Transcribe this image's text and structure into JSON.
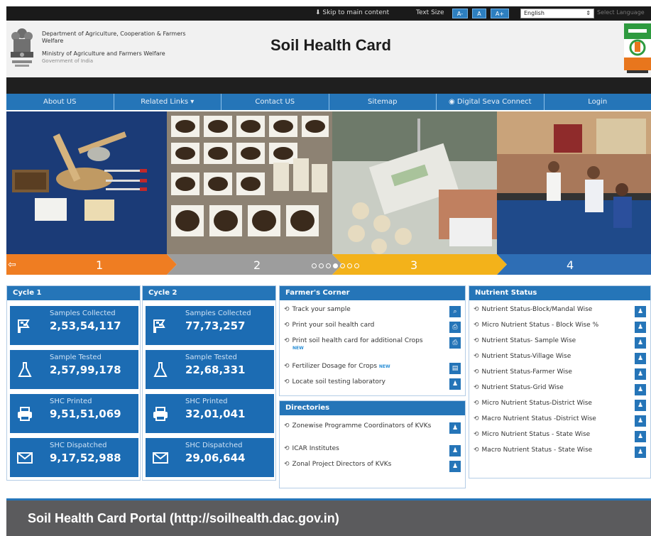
{
  "topbar": {
    "skip_label": "⬇ Skip to main content",
    "text_size_label": "Text Size",
    "size_buttons": [
      "A-",
      "A",
      "A+"
    ],
    "language_value": "English",
    "select_language_label": "Select Language"
  },
  "header": {
    "dept_line1": "Department of Agriculture, Cooperation & Farmers",
    "dept_line2": "Welfare",
    "ministry_line": "Ministry of Agriculture and Farmers Welfare",
    "goi_line": "Government of India",
    "site_title": "Soil Health Card"
  },
  "nav": {
    "items": [
      "About US",
      "Related Links ▾",
      "Contact US",
      "Sitemap",
      "Digital Seva Connect",
      "Login"
    ]
  },
  "slider": {
    "steps": [
      "1",
      "2",
      "3",
      "4"
    ],
    "step_colors": [
      "#ef7d22",
      "#9d9d9d",
      "#f3b21a",
      "#2e6eb5"
    ],
    "dot_count": 7,
    "active_dot": 3
  },
  "cycle1": {
    "title": "Cycle 1",
    "stats": [
      {
        "label": "Samples Collected",
        "value": "2,53,54,117",
        "icon": "flag-icon"
      },
      {
        "label": "Sample Tested",
        "value": "2,57,99,178",
        "icon": "flask-icon"
      },
      {
        "label": "SHC Printed",
        "value": "9,51,51,069",
        "icon": "printer-icon"
      },
      {
        "label": "SHC Dispatched",
        "value": "9,17,52,988",
        "icon": "envelope-icon"
      }
    ]
  },
  "cycle2": {
    "title": "Cycle 2",
    "stats": [
      {
        "label": "Samples Collected",
        "value": "77,73,257",
        "icon": "flag-icon"
      },
      {
        "label": "Sample Tested",
        "value": "22,68,331",
        "icon": "flask-icon"
      },
      {
        "label": "SHC Printed",
        "value": "32,01,041",
        "icon": "printer-icon"
      },
      {
        "label": "SHC Dispatched",
        "value": "29,06,644",
        "icon": "envelope-icon"
      }
    ]
  },
  "farmers_corner": {
    "title": "Farmer's Corner",
    "items": [
      "Track your sample",
      "Print your soil health card",
      "Print soil health card for additional Crops",
      "Fertilizer Dosage for Crops",
      "Locate soil testing laboratory"
    ],
    "new_badge": "NEW"
  },
  "directories": {
    "title": "Directories",
    "items": [
      "Zonewise Programme Coordinators of KVKs",
      "ICAR Institutes",
      "Zonal Project Directors of KVKs"
    ]
  },
  "nutrient_status": {
    "title": "Nutrient Status",
    "items": [
      "Nutrient Status-Block/Mandal Wise",
      "Micro Nutrient Status - Block Wise %",
      "Nutrient Status- Sample Wise",
      "Nutrient Status-Village Wise",
      "Nutrient Status-Farmer Wise",
      "Nutrient Status-Grid Wise",
      "Micro Nutrient Status-District Wise",
      "Macro Nutrient Status -District Wise",
      "Micro Nutrient Status - State Wise",
      "Macro Nutrient Status - State Wise"
    ]
  },
  "caption": "Soil Health Card Portal (http://soilhealth.dac.gov.in)"
}
